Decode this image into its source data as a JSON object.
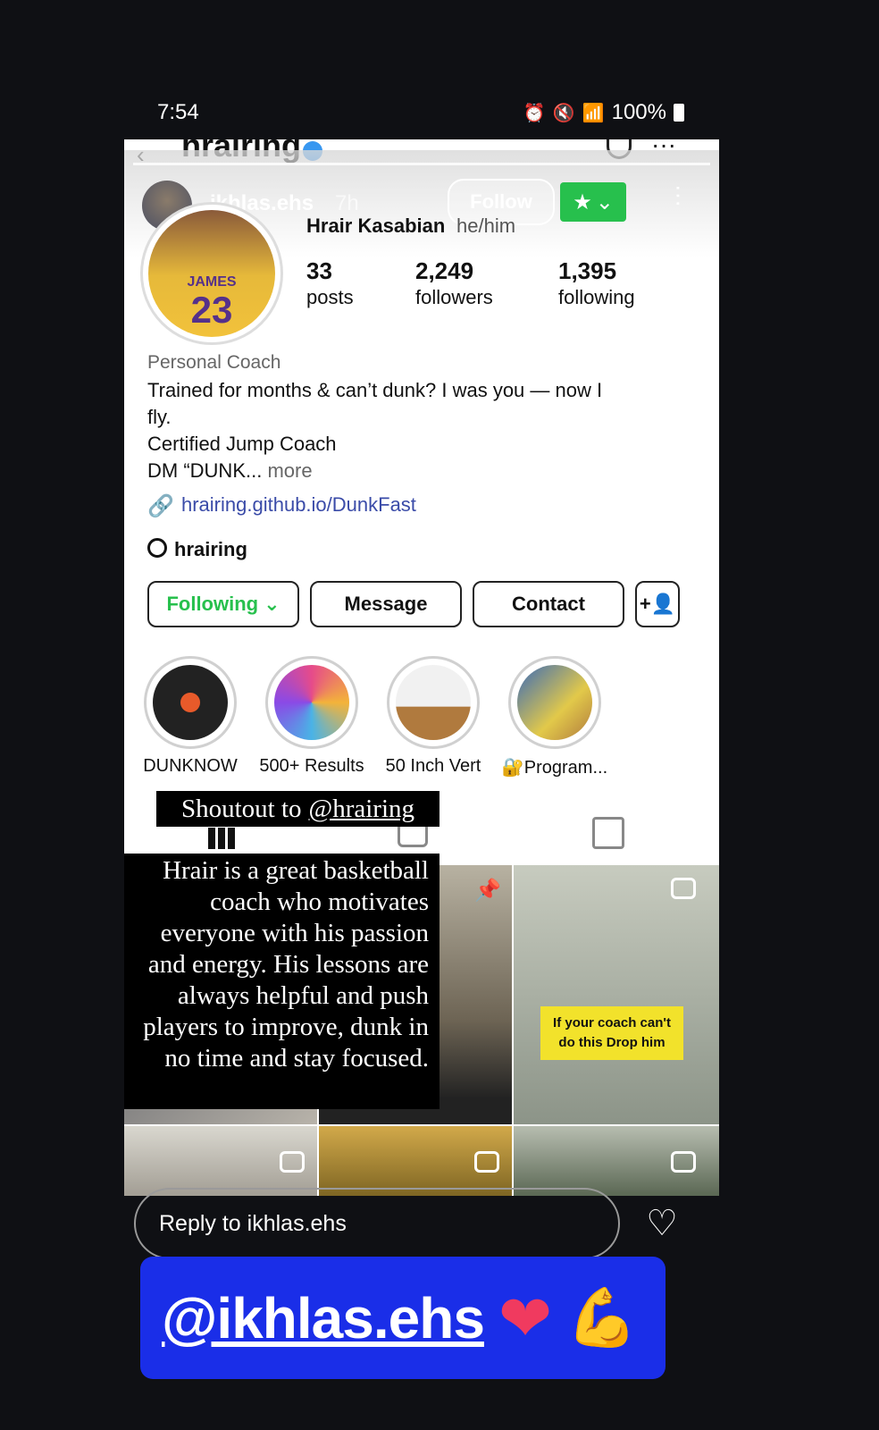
{
  "status": {
    "time": "7:54",
    "battery": "100%"
  },
  "nav": {
    "username": "hrairing"
  },
  "story": {
    "username": "ikhlas.ehs",
    "time_ago": "7h",
    "follow_label": "Follow"
  },
  "profile": {
    "jersey_name": "JAMES",
    "jersey_number": "23",
    "full_name": "Hrair Kasabian",
    "pronouns": "he/him",
    "stats": [
      {
        "num": "33",
        "label": "posts"
      },
      {
        "num": "2,249",
        "label": "followers"
      },
      {
        "num": "1,395",
        "label": "following"
      }
    ],
    "category": "Personal Coach",
    "bio": [
      "Trained for months & can’t dunk? I was you — now I",
      "fly.",
      "Certified Jump Coach",
      "DM “DUNK..."
    ],
    "bio_more": "more",
    "link": "hrairing.github.io/DunkFast",
    "threads": "hrairing"
  },
  "actions": {
    "following": "Following",
    "message": "Message",
    "contact": "Contact"
  },
  "highlights": [
    {
      "label": "DUNKNOW"
    },
    {
      "label": "500+ Results"
    },
    {
      "label": "50 Inch Vert"
    },
    {
      "label": "🔐Program..."
    }
  ],
  "grid": {
    "stairs_caption": "If your coach can't do this Drop him"
  },
  "overlay": {
    "shoutout_prefix": "Shoutout to",
    "shoutout_handle": "@hrairing",
    "quote": "Hrair is a great basketball coach who motivates everyone with his passion and energy. His lessons are always helpful and push players to improve, dunk in no time and stay focused."
  },
  "reply": {
    "placeholder": "Reply to ikhlas.ehs"
  },
  "mention": {
    "handle": "@ikhlas.ehs",
    "emoji_heart": "❤",
    "emoji_muscle": "💪"
  },
  "colors": {
    "accent_green": "#27c04d",
    "link_blue": "#3a4ba8",
    "mention_blue": "#1a2ee8"
  }
}
